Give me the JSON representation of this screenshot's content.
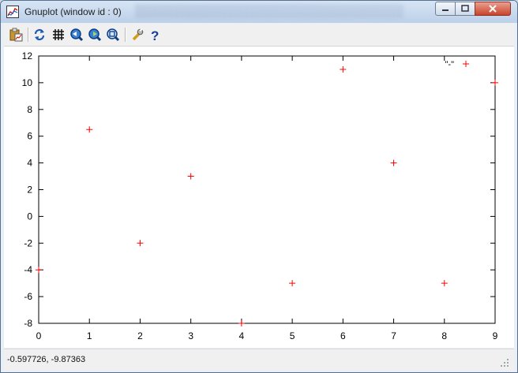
{
  "window": {
    "title": "Gnuplot (window id : 0)"
  },
  "toolbar": {
    "items": [
      "copy-to-clipboard-icon",
      "replot-icon",
      "grid-icon",
      "zoom-previous-icon",
      "zoom-next-icon",
      "autoscale-icon",
      "options-icon",
      "help-icon"
    ]
  },
  "status": {
    "coordinates": "-0.597726, -9.87363"
  },
  "colors": {
    "points": "#ff0000",
    "frame": "#000000"
  },
  "chart_data": {
    "type": "scatter",
    "title": "",
    "xlabel": "",
    "ylabel": "",
    "xlim": [
      0,
      9
    ],
    "ylim": [
      -8,
      12
    ],
    "xticks": [
      "0",
      "1",
      "2",
      "3",
      "4",
      "5",
      "6",
      "7",
      "8",
      "9"
    ],
    "yticks": [
      "-8",
      "-6",
      "-4",
      "-2",
      "0",
      "2",
      "4",
      "6",
      "8",
      "10",
      "12"
    ],
    "legend": "top-right",
    "grid": false,
    "series": [
      {
        "name": "\"-\"",
        "x": [
          0,
          1,
          2,
          3,
          4,
          5,
          6,
          7,
          8,
          9
        ],
        "y": [
          -4,
          6.5,
          -2,
          3,
          -8,
          -5,
          11,
          4,
          -5,
          10
        ]
      }
    ]
  }
}
